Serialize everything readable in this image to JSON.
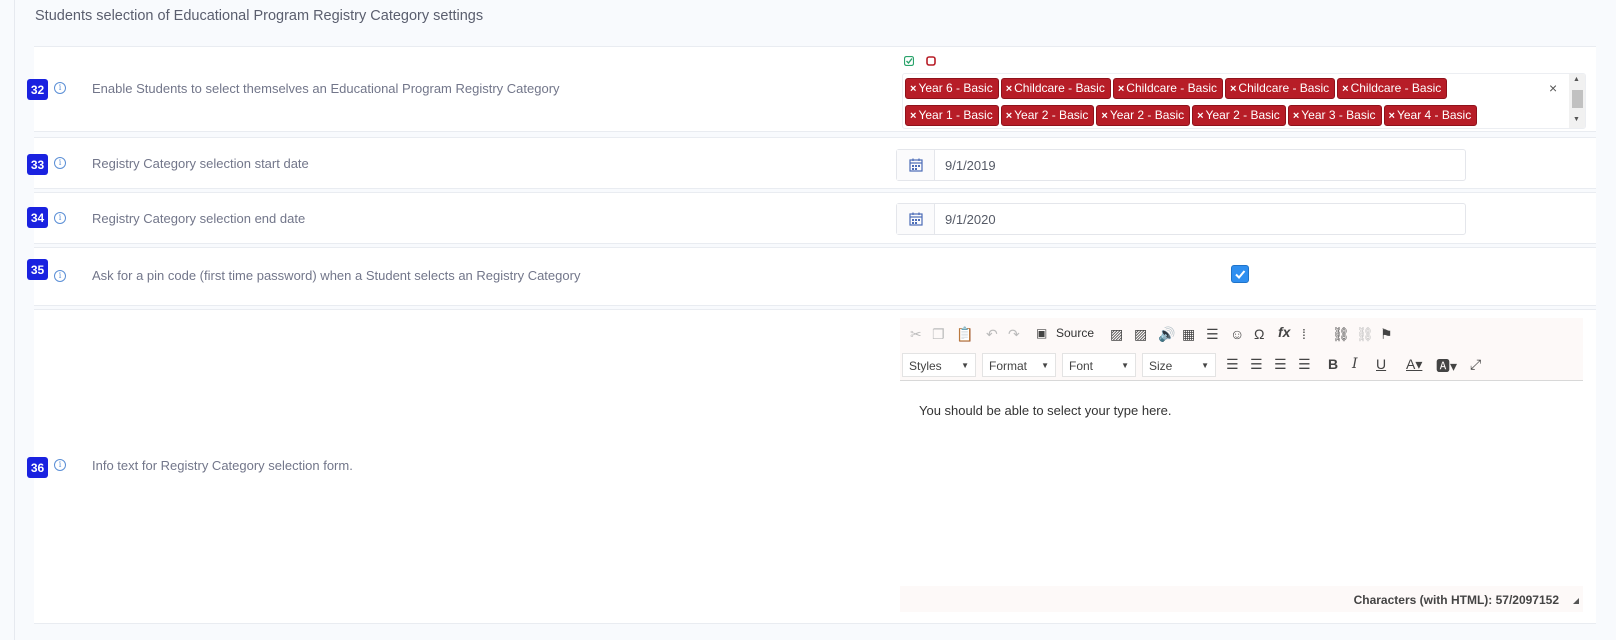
{
  "section": {
    "title": "Students selection of Educational Program Registry Category settings"
  },
  "rows": [
    {
      "num": "32",
      "label": "Enable Students to select themselves an Educational Program Registry Category"
    },
    {
      "num": "33",
      "label": "Registry Category selection start date"
    },
    {
      "num": "34",
      "label": "Registry Category selection end date"
    },
    {
      "num": "35",
      "label": "Ask for a pin code (first time password) when a Student selects an Registry Category"
    },
    {
      "num": "36",
      "label": "Info text for Registry Category selection form."
    }
  ],
  "multiselect": {
    "tags_row1": [
      "Year 6 - Basic",
      "Childcare - Basic",
      "Childcare - Basic",
      "Childcare - Basic",
      "Childcare - Basic"
    ],
    "tags_row2": [
      "Year 1 - Basic",
      "Year 2 - Basic",
      "Year 2 - Basic",
      "Year 2 - Basic",
      "Year 3 - Basic",
      "Year 4 - Basic"
    ],
    "tag_remove_glyph": "×",
    "clear_glyph": "×",
    "tag_color": "#b71d27"
  },
  "start_date": {
    "value": "9/1/2019"
  },
  "end_date": {
    "value": "9/1/2020"
  },
  "pin_code": {
    "checked": true
  },
  "editor": {
    "source_label": "Source",
    "styles_label": "Styles",
    "format_label": "Format",
    "font_label": "Font",
    "size_label": "Size",
    "content": "You should be able to select your type here.",
    "char_count": "Characters (with HTML): 57/2097152"
  },
  "colors": {
    "badge": "#1a22e0",
    "accent": "#2f8ff0"
  }
}
